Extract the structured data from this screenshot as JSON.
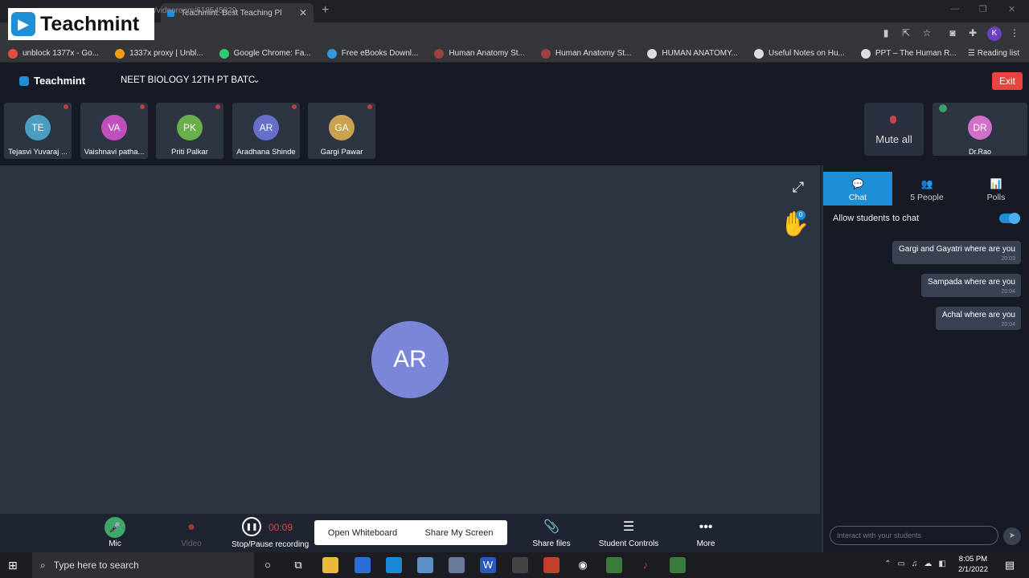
{
  "browser": {
    "logo_text": "Teachmint",
    "tab_title": "Teachmint: Best Teaching Pl",
    "url": "/videoroom/618545029",
    "reading_list": "Reading list",
    "profile_initial": "K",
    "bookmarks": [
      {
        "label": "unblock 1377x - Go...",
        "color": "#e74c3c"
      },
      {
        "label": "1337x proxy | Unbl...",
        "color": "#f39c12"
      },
      {
        "label": "Google Chrome: Fa...",
        "color": "#2ecc71"
      },
      {
        "label": "Free eBooks Downl...",
        "color": "#3498db"
      },
      {
        "label": "Human Anatomy St...",
        "color": "#a04040"
      },
      {
        "label": "Human Anatomy St...",
        "color": "#a04040"
      },
      {
        "label": "HUMAN ANATOMY...",
        "color": "#dddddd"
      },
      {
        "label": "Useful Notes on Hu...",
        "color": "#dddddd"
      },
      {
        "label": "PPT – The Human R...",
        "color": "#dddddd"
      }
    ]
  },
  "app": {
    "brand": "Teachmint",
    "class_name": "NEET BIOLOGY 12TH PT BATC",
    "exit_label": "Exit"
  },
  "participants": [
    {
      "initials": "TE",
      "name": "Tejasvi Yuvaraj ...",
      "color": "#4a9dbf"
    },
    {
      "initials": "VA",
      "name": "Vaishnavi patha...",
      "color": "#c04fbe"
    },
    {
      "initials": "PK",
      "name": "Priti Palkar",
      "color": "#6aae4a"
    },
    {
      "initials": "AR",
      "name": "Aradhana Shinde",
      "color": "#6670c9"
    },
    {
      "initials": "GA",
      "name": "Gargi Pawar",
      "color": "#c8a250"
    }
  ],
  "mute_all_label": "Mute all",
  "teacher": {
    "initials": "DR",
    "name": "Dr.Rao"
  },
  "stage": {
    "main_initials": "AR",
    "raised_hands": "0"
  },
  "controls": {
    "mic": "Mic",
    "video": "Video",
    "recording_time": "00:09",
    "recording_label": "Stop/Pause recording",
    "open_whiteboard": "Open Whiteboard",
    "share_screen": "Share My Screen",
    "share_files": "Share files",
    "student_controls": "Student Controls",
    "more": "More"
  },
  "panel": {
    "tabs": [
      {
        "label": "Chat"
      },
      {
        "label": "5 People"
      },
      {
        "label": "Polls"
      }
    ],
    "allow_chat": "Allow students to chat",
    "messages": [
      {
        "text": "Gargi and Gayatri where are you",
        "time": "20:03"
      },
      {
        "text": "Sampada where are you",
        "time": "20:04"
      },
      {
        "text": "Achal where are you",
        "time": "20:04"
      }
    ],
    "input_placeholder": "Interact with your students"
  },
  "taskbar": {
    "search_placeholder": "Type here to search",
    "time": "8:05 PM",
    "date": "2/1/2022"
  }
}
